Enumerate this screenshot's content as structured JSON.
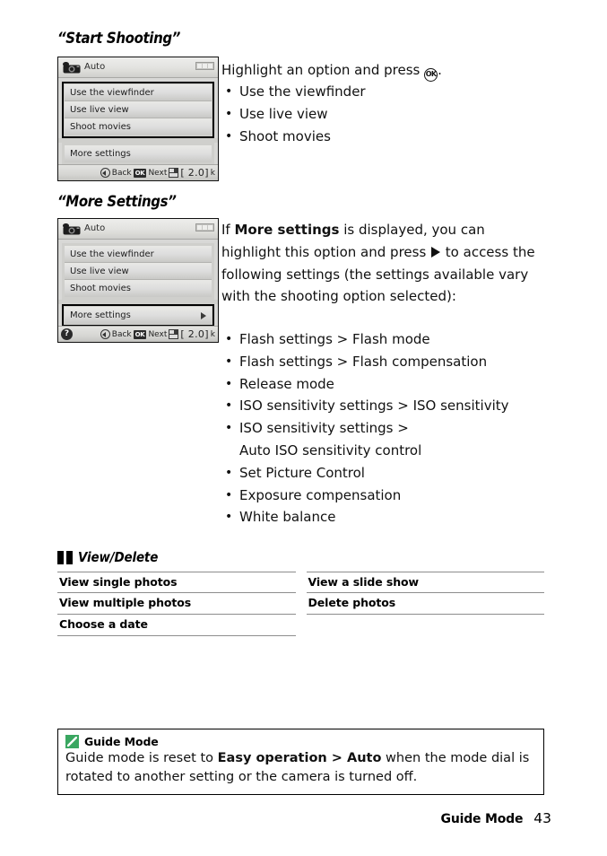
{
  "sections": {
    "start_shooting": {
      "heading": "“Start Shooting”",
      "intro_before_ok": "Highlight an option and press ",
      "ok_glyph_label": "OK",
      "intro_after_ok": ".",
      "bullets": [
        "Use the viewfinder",
        "Use live view",
        "Shoot movies"
      ]
    },
    "more_settings": {
      "heading": "“More Settings”",
      "paragraph_part1": "If ",
      "paragraph_bold": "More settings",
      "paragraph_part2": " is displayed, you can highlight this option and press ",
      "paragraph_part3": " to access the following settings (the settings available vary with the shooting option selected):",
      "bullets": [
        "Flash settings > Flash mode",
        "Flash settings > Flash compensation",
        "Release mode",
        "ISO sensitivity settings > ISO sensitivity",
        "ISO sensitivity settings >",
        "Auto ISO sensitivity control",
        "Set Picture Control",
        "Exposure compensation",
        "White balance"
      ]
    }
  },
  "lcd_screens": [
    {
      "id": "start-shooting-screen",
      "mode_label": "Auto",
      "camera_icon": "camera-icon",
      "battery_icon": "battery-icon",
      "menu_items": [
        "Use the viewfinder",
        "Use live view",
        "Shoot movies"
      ],
      "menu_group_selected": true,
      "more_settings_label": "More settings",
      "more_settings_selected": false,
      "more_settings_caret": false,
      "help_icon_visible": false,
      "help_icon_label": "?",
      "bottom_bar": {
        "back_glyph": "left-arrow-circle-icon",
        "back_label": "Back",
        "ok_glyph": "OK",
        "next_label": "Next",
        "card_glyph": "memory-card-icon",
        "capacity": "[  2.0]",
        "capacity_unit": "k"
      }
    },
    {
      "id": "more-settings-screen",
      "mode_label": "Auto",
      "camera_icon": "camera-icon",
      "battery_icon": "battery-icon",
      "menu_items": [
        "Use the viewfinder",
        "Use live view",
        "Shoot movies"
      ],
      "menu_group_selected": false,
      "more_settings_label": "More settings",
      "more_settings_selected": true,
      "more_settings_caret": true,
      "help_icon_visible": true,
      "help_icon_label": "?",
      "bottom_bar": {
        "back_glyph": "left-arrow-circle-icon",
        "back_label": "Back",
        "ok_glyph": "OK",
        "next_label": "Next",
        "card_glyph": "memory-card-icon",
        "capacity": "[  2.0]",
        "capacity_unit": "k"
      }
    }
  ],
  "view_delete": {
    "icon": "playback-bars-icon",
    "title": "View/Delete",
    "left_column": [
      "View single photos",
      "View multiple photos",
      "Choose a date"
    ],
    "right_column": [
      "View a slide show",
      "Delete photos"
    ]
  },
  "note": {
    "icon": "pencil-note-icon",
    "title": "Guide Mode",
    "text_part1": "Guide mode is reset to ",
    "text_bold1": "Easy operation > Auto",
    "text_part2": " when the mode dial is rotated to another setting or the camera is turned off."
  },
  "footer": {
    "chapter": "Guide Mode",
    "page_number": "43"
  },
  "colors": {
    "note_icon_green": "#3aa761",
    "lcd_background": "#d8d8d6",
    "rule_gray": "#8d8d8d"
  }
}
